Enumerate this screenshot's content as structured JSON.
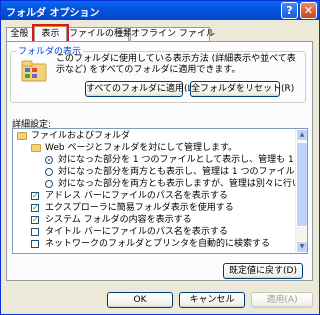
{
  "window": {
    "title": "フォルダ オプション",
    "help_glyph": "?",
    "close_glyph": "✕"
  },
  "tabs": [
    {
      "label": "全般",
      "active": false
    },
    {
      "label": "表示",
      "active": true
    },
    {
      "label": "ファイルの種類",
      "active": false
    },
    {
      "label": "オフライン ファイル",
      "active": false
    }
  ],
  "folder_view": {
    "group_label": "フォルダの表示",
    "description": "このフォルダに使用している表示方法 (詳細表示や並べて表示など) をすべてのフォルダに適用できます。",
    "apply_all_button": "すべてのフォルダに適用(L)",
    "reset_all_button": "全フォルダをリセット(R)"
  },
  "advanced": {
    "label": "詳細設定:",
    "items": [
      {
        "type": "folder",
        "indent": 0,
        "label": "ファイルおよびフォルダ"
      },
      {
        "type": "folder",
        "indent": 1,
        "label": "Web ページとフォルダを対にして管理します。"
      },
      {
        "type": "radio",
        "indent": 2,
        "checked": true,
        "label": "対になった部分を 1 つのファイルとして表示し、管理も 1 つのファイ"
      },
      {
        "type": "radio",
        "indent": 2,
        "checked": false,
        "label": "対になった部分を両方とも表示し、管理は 1 つのファイルとして行"
      },
      {
        "type": "radio",
        "indent": 2,
        "checked": false,
        "label": "対になった部分を両方とも表示しますが、管理は別々に行います。"
      },
      {
        "type": "check",
        "indent": 1,
        "checked": true,
        "label": "アドレス バーにファイルのパス名を表示する"
      },
      {
        "type": "check",
        "indent": 1,
        "checked": true,
        "label": "エクスプローラに簡易フォルダ表示を使用する"
      },
      {
        "type": "check",
        "indent": 1,
        "checked": true,
        "label": "システム フォルダの内容を表示する"
      },
      {
        "type": "check",
        "indent": 1,
        "checked": false,
        "label": "タイトル バーにファイルのパス名を表示する"
      },
      {
        "type": "check",
        "indent": 1,
        "checked": false,
        "label": "ネットワークのフォルダとプリンタを自動的に検索する"
      }
    ],
    "scroll_up_glyph": "▲",
    "scroll_down_glyph": "▼",
    "restore_button": "既定値に戻す(D)"
  },
  "footer": {
    "ok": "OK",
    "cancel": "キャンセル",
    "apply": "適用(A)"
  }
}
